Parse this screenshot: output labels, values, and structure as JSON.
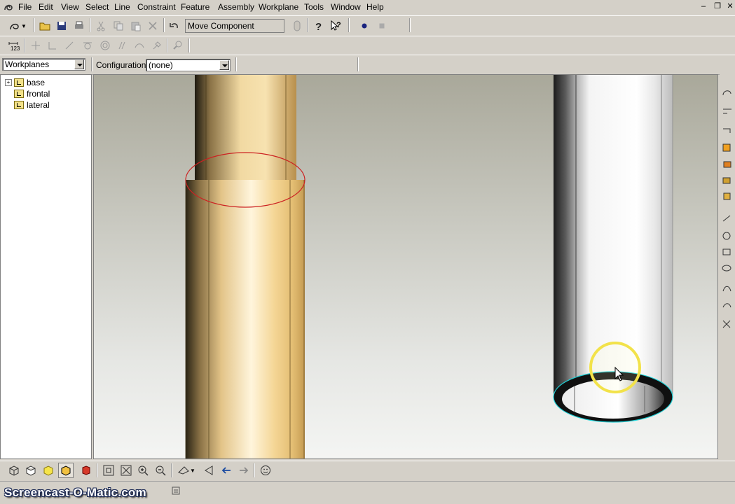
{
  "menu": {
    "items": [
      "File",
      "Edit",
      "View",
      "Select",
      "Line",
      "Constraint",
      "Feature",
      "Assembly",
      "Workplane",
      "Tools",
      "Window",
      "Help"
    ]
  },
  "toolbar": {
    "command_label": "Move Component"
  },
  "tree_panel": {
    "selector_value": "Workplanes",
    "items": [
      {
        "label": "base",
        "expandable": true
      },
      {
        "label": "frontal",
        "expandable": false
      },
      {
        "label": "lateral",
        "expandable": false
      }
    ]
  },
  "configuration": {
    "label": "Configuration:",
    "value": "(none)"
  },
  "viewport": {
    "objects": [
      "gold-cylinder",
      "white-tube"
    ],
    "gold_color": "#f5d99a",
    "selection_color": "#cc2222",
    "highlight_color": "#1fd0d6",
    "cursor_ring_color": "#f2e24a"
  },
  "watermark": "Screencast-O-Matic.com"
}
